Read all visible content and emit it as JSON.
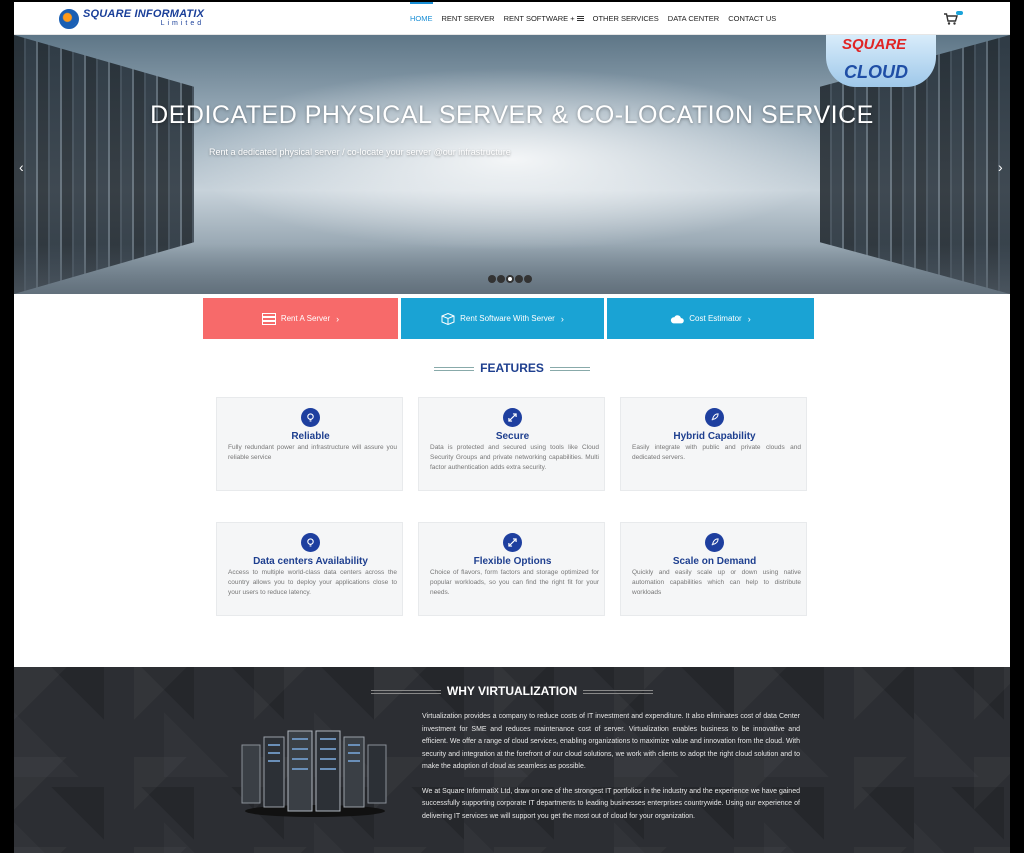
{
  "header": {
    "logo_main": "SQUARE INFORMATIX",
    "logo_sub": "Limited",
    "nav": [
      "HOME",
      "RENT SERVER",
      "RENT SOFTWARE +",
      "OTHER SERVICES",
      "DATA CENTER",
      "CONTACT US"
    ]
  },
  "hero": {
    "title": "DEDICATED PHYSICAL SERVER & CO-LOCATION SERVICE",
    "subtitle": "Rent a dedicated physical server / co-locate your server @our infrastructure",
    "badge_line1": "SQUARE",
    "badge_line2": "CLOUD",
    "prev_icon": "chevron-left-icon",
    "next_icon": "chevron-right-icon"
  },
  "cta": [
    {
      "label": "Rent A Server",
      "icon": "server-icon",
      "color": "#f76a6a"
    },
    {
      "label": "Rent Software With Server",
      "icon": "cube-icon",
      "color": "#1aa3d4"
    },
    {
      "label": "Cost Estimator",
      "icon": "cloud-icon",
      "color": "#1aa3d4"
    }
  ],
  "features": {
    "title": "FEATURES",
    "items": [
      {
        "title": "Reliable",
        "icon": "lightbulb-icon",
        "desc": "Fully redundant power and infrastructure will assure you reliable service"
      },
      {
        "title": "Secure",
        "icon": "expand-arrows-icon",
        "desc": "Data is protected and secured using tools like Cloud Security Groups and private networking capabilities. Multi factor authentication adds extra security."
      },
      {
        "title": "Hybrid Capability",
        "icon": "rocket-icon",
        "desc": "Easily integrate with public and private clouds and dedicated servers."
      },
      {
        "title": "Data centers Availability",
        "icon": "lightbulb-icon",
        "desc": "Access to multiple world-class data centers across the country allows you to deploy your applications close to your users to reduce latency."
      },
      {
        "title": "Flexible Options",
        "icon": "expand-arrows-icon",
        "desc": "Choice of flavors, form factors and storage optimized for popular workloads, so you can find the right fit for your needs."
      },
      {
        "title": "Scale on Demand",
        "icon": "rocket-icon",
        "desc": "Quickly and easily scale up or down using native automation capabilities which can help to distribute workloads"
      }
    ]
  },
  "virtualization": {
    "title": "WHY VIRTUALIZATION",
    "para1": "Virtualization provides a company to reduce costs of IT investment and expenditure. It also eliminates cost of data Center investment for SME and reduces maintenance cost of server. Virtualization enables business to be innovative and efficient. We offer a range of cloud services, enabling organizations to maximize value and innovation from the cloud. With security and integration at the forefront of our cloud solutions, we work with clients to adopt the right cloud solution and to make the adoption of cloud as seamless as possible.",
    "para2": "We at Square InformatiX Ltd, draw on one of the strongest IT portfolios in the industry and the experience we have gained successfully supporting corporate IT departments to leading businesses enterprises countrywide. Using our experience of delivering IT services we will support you get the most out of cloud for your organization."
  },
  "colors": {
    "accent": "#1a8fd6",
    "navy": "#1e3f8f",
    "coral": "#f76a6a",
    "cyan": "#1aa3d4"
  }
}
